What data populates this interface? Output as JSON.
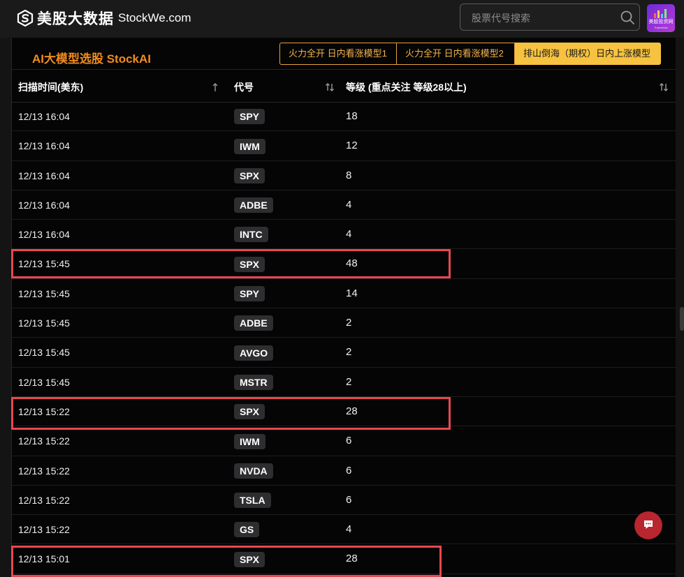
{
  "header": {
    "logo_cn": "美股大数据",
    "logo_en": "StockWe.com",
    "search_placeholder": "股票代号搜索",
    "avatar_text": "美股投资网",
    "avatar_sub": "TradesMax"
  },
  "panel": {
    "title": "AI大模型选股 StockAI",
    "tabs": [
      {
        "label": "火力全开 日内看涨模型1",
        "active": false
      },
      {
        "label": "火力全开 日内看涨模型2",
        "active": false
      },
      {
        "label": "排山倒海（期权）日内上涨模型",
        "active": true
      }
    ]
  },
  "table": {
    "headers": [
      "扫描时间(美东)",
      "代号",
      "等级 (重点关注 等级28以上)"
    ],
    "rows": [
      {
        "time": "12/13 16:04",
        "code": "SPY",
        "level": "18"
      },
      {
        "time": "12/13 16:04",
        "code": "IWM",
        "level": "12"
      },
      {
        "time": "12/13 16:04",
        "code": "SPX",
        "level": "8"
      },
      {
        "time": "12/13 16:04",
        "code": "ADBE",
        "level": "4"
      },
      {
        "time": "12/13 16:04",
        "code": "INTC",
        "level": "4"
      },
      {
        "time": "12/13 15:45",
        "code": "SPX",
        "level": "48"
      },
      {
        "time": "12/13 15:45",
        "code": "SPY",
        "level": "14"
      },
      {
        "time": "12/13 15:45",
        "code": "ADBE",
        "level": "2"
      },
      {
        "time": "12/13 15:45",
        "code": "AVGO",
        "level": "2"
      },
      {
        "time": "12/13 15:45",
        "code": "MSTR",
        "level": "2"
      },
      {
        "time": "12/13 15:22",
        "code": "SPX",
        "level": "28"
      },
      {
        "time": "12/13 15:22",
        "code": "IWM",
        "level": "6"
      },
      {
        "time": "12/13 15:22",
        "code": "NVDA",
        "level": "6"
      },
      {
        "time": "12/13 15:22",
        "code": "TSLA",
        "level": "6"
      },
      {
        "time": "12/13 15:22",
        "code": "GS",
        "level": "4"
      },
      {
        "time": "12/13 15:01",
        "code": "SPX",
        "level": "28"
      }
    ]
  },
  "colors": {
    "accent": "#f08c1e",
    "tab_active_bg": "#f7c23f",
    "highlight": "#e8484f",
    "chat_button": "#b8262f"
  },
  "icons": [
    "logo-s-icon",
    "search-icon",
    "sort-icon",
    "chat-icon"
  ]
}
